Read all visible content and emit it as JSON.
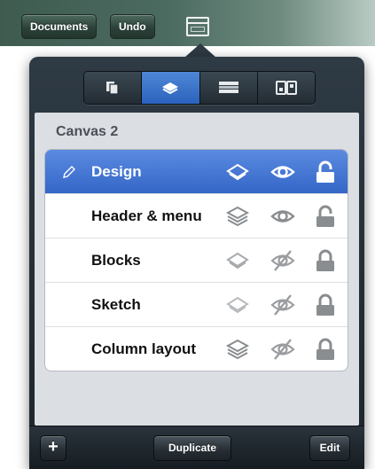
{
  "toolbar": {
    "documents_label": "Documents",
    "undo_label": "Undo",
    "grid_icon": "layout-grid-icon"
  },
  "popover": {
    "segments": [
      {
        "icon": "pages-icon",
        "active": false
      },
      {
        "icon": "layers-icon",
        "active": true
      },
      {
        "icon": "list-icon",
        "active": false
      },
      {
        "icon": "components-icon",
        "active": false
      }
    ],
    "canvas_title": "Canvas 2",
    "layers": [
      {
        "name": "Design",
        "selected": true,
        "editing": true,
        "layers_icon": "layers-outline",
        "visible": true,
        "locked": false
      },
      {
        "name": "Header & menu",
        "selected": false,
        "editing": false,
        "layers_icon": "layers-stack",
        "visible": true,
        "locked": false
      },
      {
        "name": "Blocks",
        "selected": false,
        "editing": false,
        "layers_icon": "layers-outline",
        "visible": false,
        "locked": true
      },
      {
        "name": "Sketch",
        "selected": false,
        "editing": false,
        "layers_icon": "layers-outline",
        "visible": false,
        "locked": true
      },
      {
        "name": "Column layout",
        "selected": false,
        "editing": false,
        "layers_icon": "layers-stack",
        "visible": false,
        "locked": true
      }
    ],
    "bottom": {
      "add_label": "+",
      "duplicate_label": "Duplicate",
      "edit_label": "Edit"
    }
  },
  "colors": {
    "selection": "#3b6fd0",
    "popover_bg": "#1d252c",
    "panel_bg": "#dbdee3"
  }
}
